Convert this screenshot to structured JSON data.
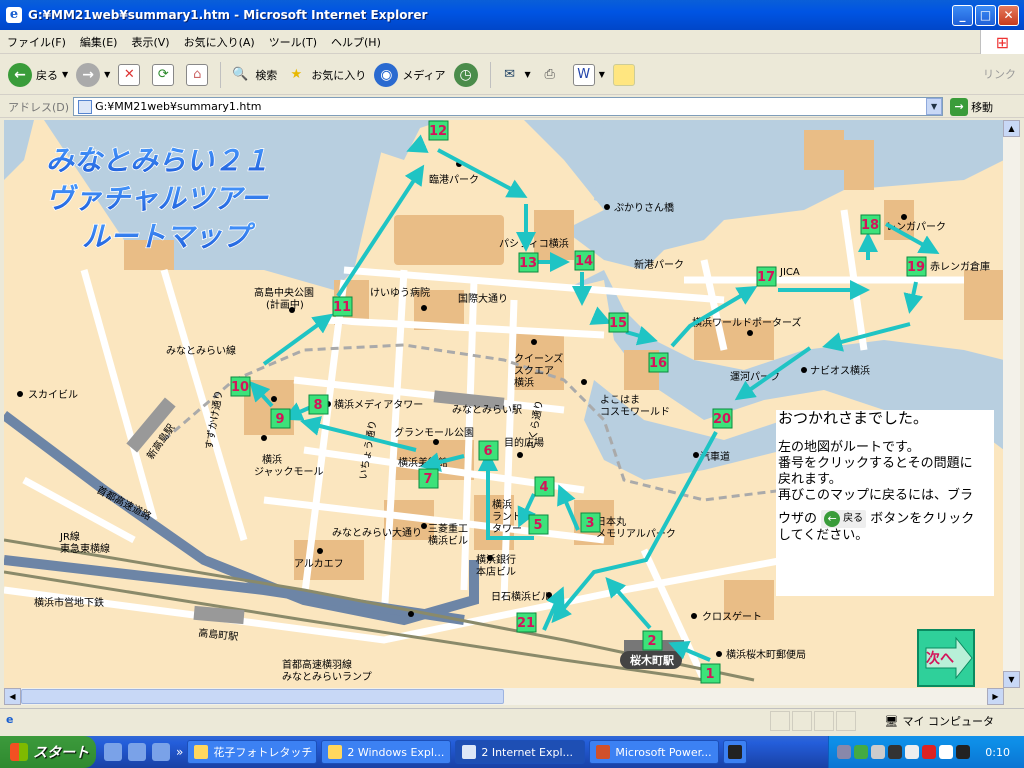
{
  "window": {
    "title": "G:¥MM21web¥summary1.htm - Microsoft Internet Explorer",
    "app_icon": "ie-page-icon",
    "controls": [
      "_",
      "□",
      "X"
    ]
  },
  "menu": [
    "ファイル(F)",
    "編集(E)",
    "表示(V)",
    "お気に入り(A)",
    "ツール(T)",
    "ヘルプ(H)"
  ],
  "toolbar": {
    "back": "戻る",
    "search": "検索",
    "favorites": "お気に入り",
    "media": "メディア",
    "links": "リンク"
  },
  "address": {
    "label": "アドレス(D)",
    "value": "G:¥MM21web¥summary1.htm",
    "go": "移動"
  },
  "page": {
    "title_lines": [
      "みなとみらい２１",
      "ヴァチャルツアー",
      "ルートマップ"
    ],
    "message": {
      "thanks": "おつかれさまでした。",
      "lines": [
        "左の地図がルートです。",
        "番号をクリックするとその問題に",
        "戻れます。",
        "再びこのマップに戻るには、ブラ"
      ],
      "before_icon": "ウザの",
      "icon_label": "戻る",
      "after_icon": "ボタンをクリック",
      "last_line": "してください。"
    },
    "next_button": "次へ",
    "route_numbers": [
      "1",
      "2",
      "3",
      "4",
      "5",
      "6",
      "7",
      "8",
      "9",
      "10",
      "11",
      "12",
      "13",
      "14",
      "15",
      "16",
      "17",
      "18",
      "19",
      "20",
      "21"
    ],
    "map_labels": {
      "rinko_park": "臨港パーク",
      "pukari": "ぷかりさん橋",
      "pacifico": "パシフィコ横浜",
      "shinko_park": "新港パーク",
      "keiyu": "けいゆう病院",
      "kokusai": "国際大通り",
      "takashima": "高島中央公園",
      "keikaku": "(計画中)",
      "mm_line": "みなとみらい線",
      "queens1": "クイーンズ",
      "queens2": "スクエア",
      "queens3": "横浜",
      "mm_station": "みなとみらい駅",
      "yokohama_world": "横浜ワールドポーターズ",
      "jica": "JICA",
      "akarenga_park": "レンガパーク",
      "akarenga": "赤レンガ倉庫",
      "navios": "ナビオス横浜",
      "unga": "運河パーク",
      "cosmo1": "よこはま",
      "cosmo2": "コスモワールド",
      "skybill": "スカイビル",
      "shintakashima": "新高島駅",
      "media_tower": "横浜メディアタワー",
      "grandmall": "グランモール公園",
      "museum": "横浜美術館",
      "jack1": "横浜",
      "jack2": "ジャックモール",
      "mokuteki": "目的広場",
      "landmark1": "横浜",
      "landmark2": "ランド",
      "landmark3": "タワー",
      "mitsubishi1": "三菱重工",
      "mitsubishi2": "横浜ビル",
      "honmaru1": "日本丸",
      "honmaru2": "メモリアルパーク",
      "kisen": "汽車道",
      "bank1": "横浜銀行",
      "bank2": "本店ビル",
      "nisseki": "日石横浜ビル",
      "crossgate": "クロスゲート",
      "sakuragicho_post": "横浜桜木町郵便局",
      "sakuragicho": "桜木町駅",
      "mm_odori": "みなとみらい大通り",
      "arca": "アルカエフ",
      "shuto_exp": "首都高速道路",
      "jr1": "JR線",
      "jr2": "東急東横線",
      "subway": "横浜市営地下鉄",
      "takashimacho": "高島町駅",
      "ramp1": "首都高速横羽線",
      "ramp2": "みなとみらいランプ",
      "sakura": "さくら通り",
      "itcho": "いちょう通り",
      "sakurast": "すずかけ通り"
    }
  },
  "status": {
    "zone": "マイ コンピュータ"
  },
  "taskbar": {
    "start": "スタート",
    "tasks": [
      "花子フォトレタッチ",
      "2 Windows Expl...",
      "2 Internet Expl...",
      "Microsoft Power..."
    ],
    "clock": "0:10"
  }
}
